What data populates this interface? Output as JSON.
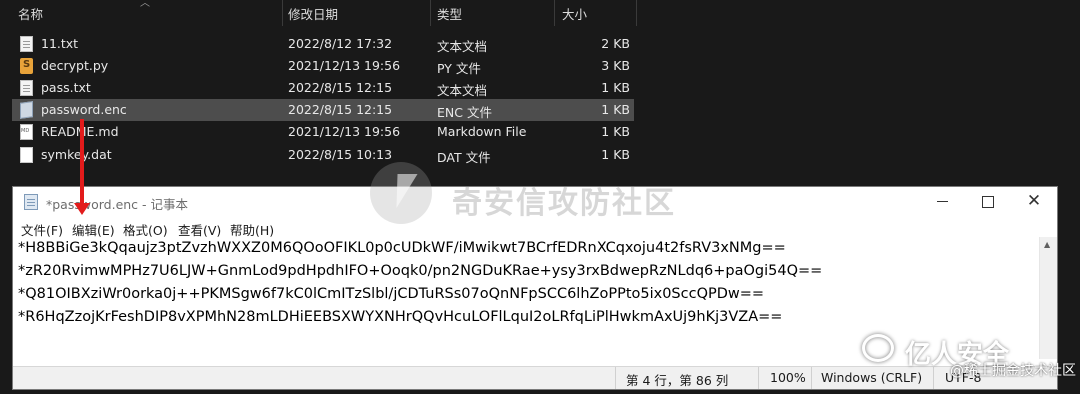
{
  "explorer": {
    "columns": {
      "name": "名称",
      "date": "修改日期",
      "type": "类型",
      "size": "大小"
    },
    "files": [
      {
        "name": "11.txt",
        "date": "2022/8/12 17:32",
        "type": "文本文档",
        "size": "2 KB",
        "icon": "text-file-icon"
      },
      {
        "name": "decrypt.py",
        "date": "2021/12/13 19:56",
        "type": "PY 文件",
        "size": "3 KB",
        "icon": "python-file-icon"
      },
      {
        "name": "pass.txt",
        "date": "2022/8/15 12:15",
        "type": "文本文档",
        "size": "1 KB",
        "icon": "text-file-icon"
      },
      {
        "name": "password.enc",
        "date": "2022/8/15 12:15",
        "type": "ENC 文件",
        "size": "1 KB",
        "icon": "enc-file-icon"
      },
      {
        "name": "README.md",
        "date": "2021/12/13 19:56",
        "type": "Markdown File",
        "size": "1 KB",
        "icon": "markdown-file-icon"
      },
      {
        "name": "symkey.dat",
        "date": "2022/8/15 10:13",
        "type": "DAT 文件",
        "size": "1 KB",
        "icon": "dat-file-icon"
      }
    ],
    "selected_index": 3
  },
  "notepad": {
    "title": "*password.enc - 记事本",
    "menu": [
      "文件(F)",
      "编辑(E)",
      "格式(O)",
      "查看(V)",
      "帮助(H)"
    ],
    "lines": [
      "*H8BBiGe3kQqaujz3ptZvzhWXXZ0M6QOoOFIKL0p0cUDkWF/iMwikwt7BCrfEDRnXCqxoju4t2fsRV3xNMg==",
      "*zR20RvimwMPHz7U6LJW+GnmLod9pdHpdhIFO+Ooqk0/pn2NGDuKRae+ysy3rxBdwepRzNLdq6+paOgi54Q==",
      "*Q81OIBXziWr0orka0j++PKMSgw6f7kC0lCmITzSlbl/jCDTuRSs07oQnNFpSCC6lhZoPPto5ix0SccQPDw==",
      "*R6HqZzojKrFeshDIP8vXPMhN28mLDHiEEBSXWYXNHrQQvHcuLOFlLquI2oLRfqLiPlHwkmAxUj9hKj3VZA=="
    ],
    "status": {
      "position": "第 4 行，第 86 列",
      "zoom": "100%",
      "line_ending": "Windows (CRLF)",
      "encoding": "UTF-8"
    }
  },
  "watermarks": {
    "center": "奇安信攻防社区",
    "wechat": "亿人安全",
    "site": "@稀土掘金技术社区"
  },
  "colors": {
    "annotation_arrow": "#e21b1b",
    "explorer_bg": "#191919",
    "selected_row": "#4d4d4d"
  }
}
